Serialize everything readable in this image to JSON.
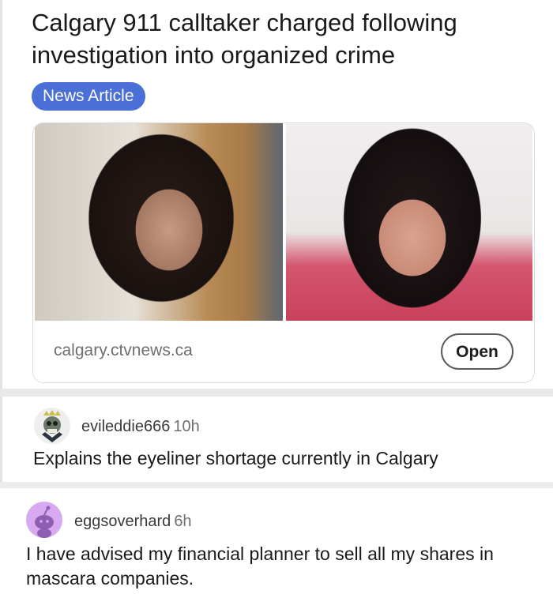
{
  "post": {
    "title": "Calgary 911 calltaker charged following investigation into organized crime",
    "flair": "News Article",
    "link": {
      "domain": "calgary.ctvnews.ca",
      "open_label": "Open"
    }
  },
  "comments": [
    {
      "author": "evileddie666",
      "age": "10h",
      "body": "Explains the eyeliner shortage currently in Calgary",
      "avatar_icon": "skull-avatar-icon"
    },
    {
      "author": "eggsoverhard",
      "age": "6h",
      "body": "I have advised my financial planner to sell all my shares in mascara companies.",
      "avatar_icon": "snoo-avatar-icon"
    }
  ],
  "colors": {
    "flair_bg": "#4a6fd6",
    "avatar_purple": "#d8a9f0"
  }
}
